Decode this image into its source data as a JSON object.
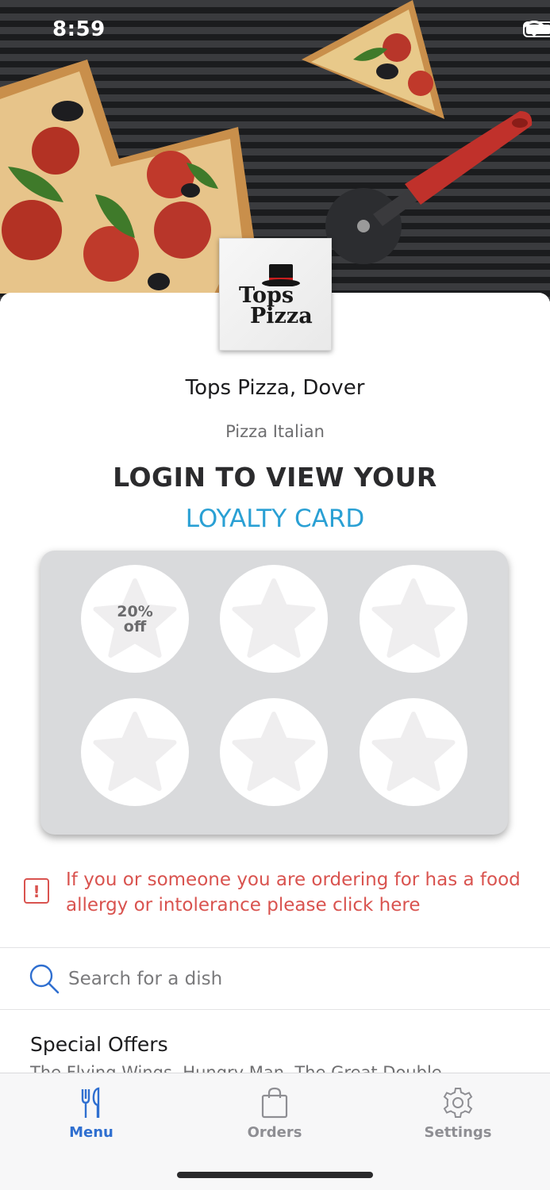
{
  "status_bar": {
    "time": "8:59"
  },
  "restaurant": {
    "logo_line1": "Tops",
    "logo_line2": "Pizza",
    "name": "Tops Pizza, Dover",
    "cuisine": "Pizza Italian"
  },
  "loyalty": {
    "title": "LOGIN TO VIEW YOUR",
    "link": "LOYALTY CARD",
    "stamps": [
      {
        "label_line1": "20%",
        "label_line2": "off"
      },
      {
        "label_line1": "",
        "label_line2": ""
      },
      {
        "label_line1": "",
        "label_line2": ""
      },
      {
        "label_line1": "",
        "label_line2": ""
      },
      {
        "label_line1": "",
        "label_line2": ""
      },
      {
        "label_line1": "",
        "label_line2": ""
      }
    ]
  },
  "allergy": {
    "icon": "exclamation-icon",
    "text": "If you or someone you are ordering for has a food allergy or intolerance please click here"
  },
  "search": {
    "placeholder": "Search for a dish"
  },
  "menu": {
    "section_title": "Special Offers",
    "section_subtitle": "The Flying Wings, Hungry Man, The Great Double"
  },
  "tabs": [
    {
      "label": "Menu",
      "icon": "fork-knife-icon",
      "active": true
    },
    {
      "label": "Orders",
      "icon": "bag-icon",
      "active": false
    },
    {
      "label": "Settings",
      "icon": "gear-icon",
      "active": false
    }
  ],
  "colors": {
    "accent": "#2aa0d4",
    "tab_active": "#2f6fd0",
    "warning": "#d9534f"
  }
}
